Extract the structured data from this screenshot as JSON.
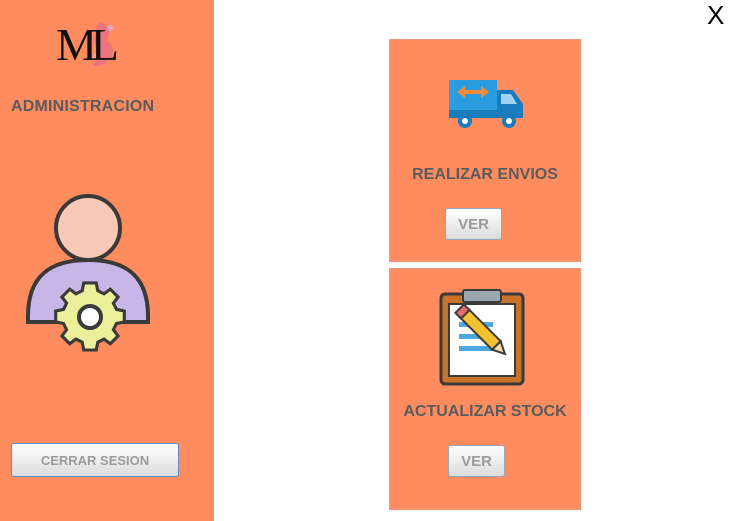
{
  "sidebar": {
    "logo_text": "ML",
    "title": "ADMINISTRACION",
    "logout_label": "CERRAR SESION",
    "avatar_icon": "admin-user-gear-icon"
  },
  "window": {
    "close_label": "X"
  },
  "cards": [
    {
      "icon": "truck-icon",
      "label": "REALIZAR ENVIOS",
      "button": "VER"
    },
    {
      "icon": "clipboard-edit-icon",
      "label": "ACTUALIZAR STOCK",
      "button": "VER"
    }
  ],
  "colors": {
    "panel": "#ff8c5f",
    "text": "#5b5b5b",
    "button_text": "#9b9b9b",
    "background": "#ffffff"
  }
}
